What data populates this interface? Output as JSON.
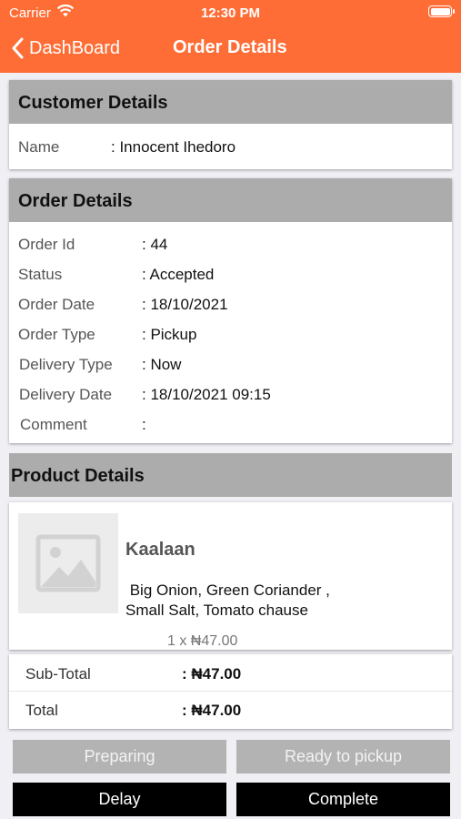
{
  "status_bar": {
    "carrier": "Carrier",
    "time": "12:30 PM"
  },
  "nav": {
    "back_label": "DashBoard",
    "title": "Order Details"
  },
  "customer": {
    "heading": "Customer Details",
    "name_label": "Name",
    "name_value": ": Innocent  Ihedoro"
  },
  "order": {
    "heading": "Order Details",
    "fields": [
      {
        "label": "Order Id",
        "value": ": 44"
      },
      {
        "label": "Status",
        "value": ": Accepted"
      },
      {
        "label": "Order Date",
        "value": ": 18/10/2021"
      },
      {
        "label": "Order Type",
        "value": ": Pickup"
      },
      {
        "label": "Delivery Type",
        "value": ": Now"
      },
      {
        "label": "Delivery Date",
        "value": ": 18/10/2021 09:15"
      },
      {
        "label": "Comment",
        "value": ":"
      }
    ]
  },
  "product": {
    "heading": "Product Details",
    "name": "Kaalaan",
    "ingredients_line1": " Big Onion, Green Coriander ,",
    "ingredients_line2": "Small Salt, Tomato chause",
    "qty_price": "1 x ₦47.00",
    "icon": "image-placeholder-icon"
  },
  "totals": {
    "subtotal_label": "Sub-Total",
    "subtotal_value": ": ₦47.00",
    "total_label": "Total",
    "total_value": ": ₦47.00"
  },
  "actions": {
    "preparing": "Preparing",
    "ready": "Ready to pickup",
    "delay": "Delay",
    "complete": "Complete"
  },
  "colors": {
    "accent": "#ff6d36",
    "section_header": "#acacac",
    "button_disabled": "#b3b3b3",
    "button_dark": "#000000"
  }
}
